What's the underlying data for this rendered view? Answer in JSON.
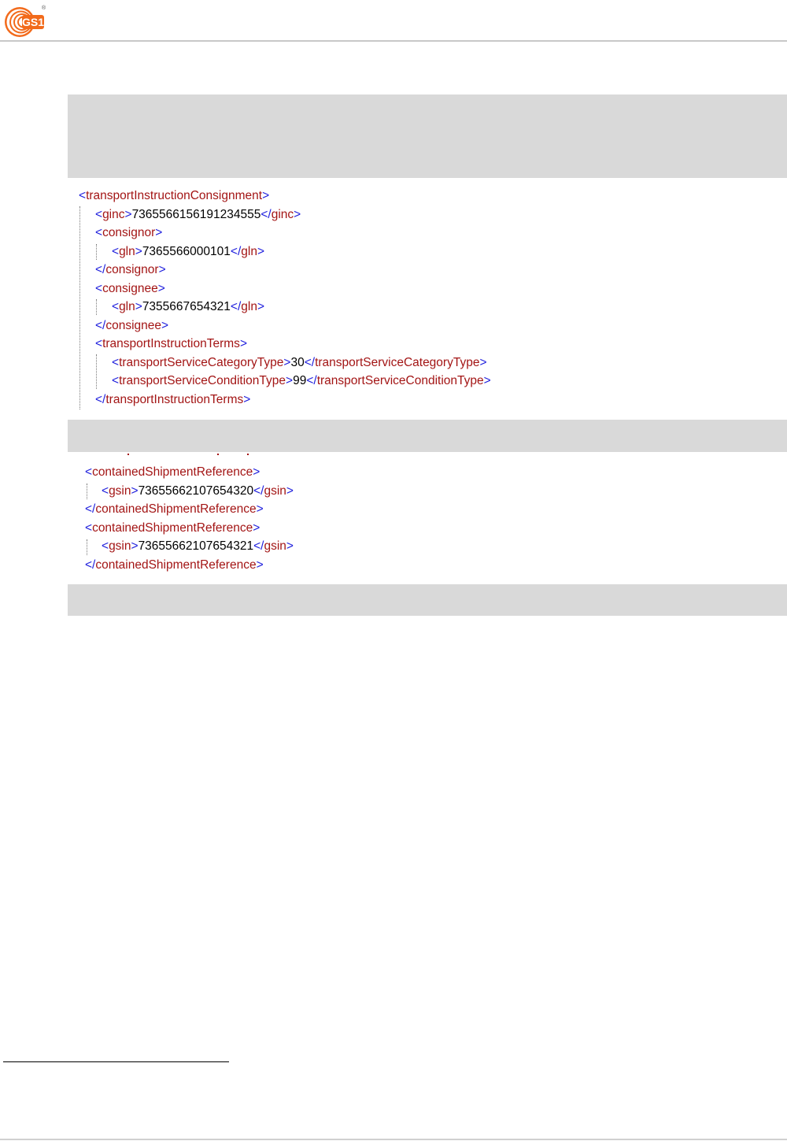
{
  "header": {
    "logo_text": "GS1",
    "logo_registered": "®"
  },
  "xml_block_1": [
    {
      "indent": 0,
      "kind": "open",
      "tag": "transportInstructionConsignment"
    },
    {
      "indent": 1,
      "kind": "element",
      "tag": "ginc",
      "value": "7365566156191234555"
    },
    {
      "indent": 1,
      "kind": "open",
      "tag": "consignor"
    },
    {
      "indent": 2,
      "kind": "element",
      "tag": "gln",
      "value": "7365566000101"
    },
    {
      "indent": 1,
      "kind": "close",
      "tag": "consignor"
    },
    {
      "indent": 1,
      "kind": "open",
      "tag": "consignee"
    },
    {
      "indent": 2,
      "kind": "element",
      "tag": "gln",
      "value": "7355667654321"
    },
    {
      "indent": 1,
      "kind": "close",
      "tag": "consignee"
    },
    {
      "indent": 1,
      "kind": "open",
      "tag": "transportInstructionTerms"
    },
    {
      "indent": 2,
      "kind": "element",
      "tag": "transportServiceCategoryType",
      "value": "30"
    },
    {
      "indent": 2,
      "kind": "element",
      "tag": "transportServiceConditionType",
      "value": "99"
    },
    {
      "indent": 1,
      "kind": "close",
      "tag": "transportInstructionTerms"
    }
  ],
  "xml_block_2": [
    {
      "indent": 0,
      "kind": "open",
      "tag": "containedShipmentReference"
    },
    {
      "indent": 1,
      "kind": "element",
      "tag": "gsin",
      "value": "73655662107654320"
    },
    {
      "indent": 0,
      "kind": "close",
      "tag": "containedShipmentReference"
    },
    {
      "indent": 0,
      "kind": "open",
      "tag": "containedShipmentReference"
    },
    {
      "indent": 1,
      "kind": "element",
      "tag": "gsin",
      "value": "73655662107654321"
    },
    {
      "indent": 0,
      "kind": "close",
      "tag": "containedShipmentReference"
    }
  ]
}
